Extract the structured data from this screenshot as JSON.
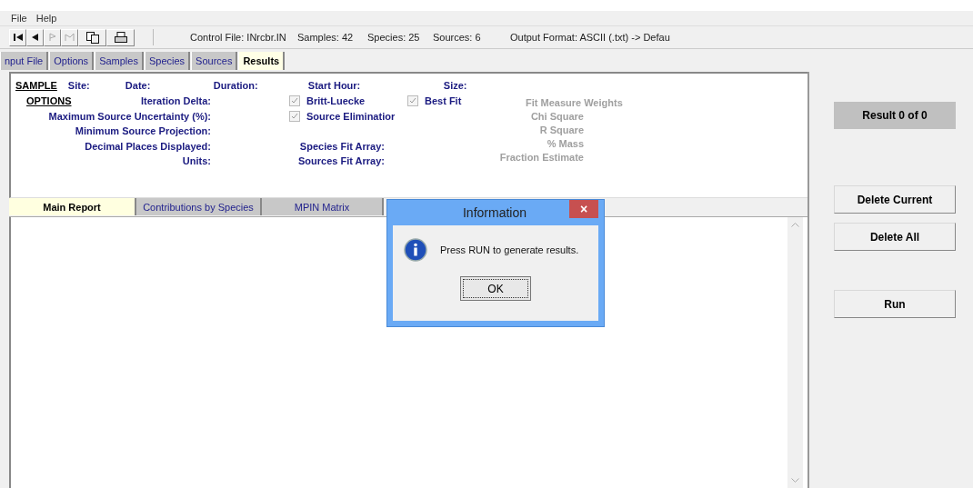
{
  "menu": [
    "File",
    "Help"
  ],
  "toolbar": {
    "buttons": [
      {
        "kind": "first",
        "disabled": false
      },
      {
        "kind": "prev",
        "disabled": false
      },
      {
        "kind": "next",
        "disabled": true
      },
      {
        "kind": "last",
        "disabled": true
      },
      {
        "kind": "copy",
        "disabled": false
      },
      {
        "kind": "print",
        "disabled": false
      }
    ],
    "status": [
      "Control File: INrcbr.IN",
      "Samples: 42",
      "Species: 25",
      "Sources: 6",
      "Output Format: ASCII (.txt) -> Defau"
    ]
  },
  "tabs": [
    {
      "label": "nput File",
      "selected": false
    },
    {
      "label": "Options",
      "selected": false
    },
    {
      "label": "Samples",
      "selected": false
    },
    {
      "label": "Species",
      "selected": false
    },
    {
      "label": "Sources",
      "selected": false
    },
    {
      "label": "Results",
      "selected": true
    }
  ],
  "sample": {
    "heading": "SAMPLE",
    "fields": [
      "Site:",
      "Date:",
      "Duration:",
      "Start Hour:",
      "Size:"
    ]
  },
  "options": {
    "heading": "OPTIONS",
    "labels": [
      "Iteration Delta:",
      "Maximum Source Uncertainty (%):",
      "Minimum Source Projection:",
      "Decimal Places Displayed:",
      "Units:"
    ],
    "checkboxes": [
      {
        "label": "Britt-Luecke",
        "checked": true,
        "disabled": true
      },
      {
        "label": "Source Eliminatior",
        "checked": true,
        "disabled": true
      },
      {
        "label": "Best Fit",
        "checked": true,
        "disabled": true
      }
    ],
    "arrays": [
      "Species Fit Array:",
      "Sources Fit Array:"
    ],
    "fit_measure": {
      "heading": "Fit Measure Weights",
      "items": [
        "Chi Square",
        "R Square",
        "% Mass",
        "Fraction Estimate"
      ],
      "disabled": true
    }
  },
  "report_tabs": [
    {
      "label": "Main Report",
      "selected": true
    },
    {
      "label": "Contributions by Species",
      "selected": false
    },
    {
      "label": "MPIN Matrix",
      "selected": false
    }
  ],
  "side": {
    "result": "Result 0 of 0",
    "buttons": [
      "Delete Current",
      "Delete All",
      "Run"
    ]
  },
  "dialog": {
    "title": "Information",
    "close": "×",
    "message": "Press RUN to generate results.",
    "button": "OK"
  }
}
